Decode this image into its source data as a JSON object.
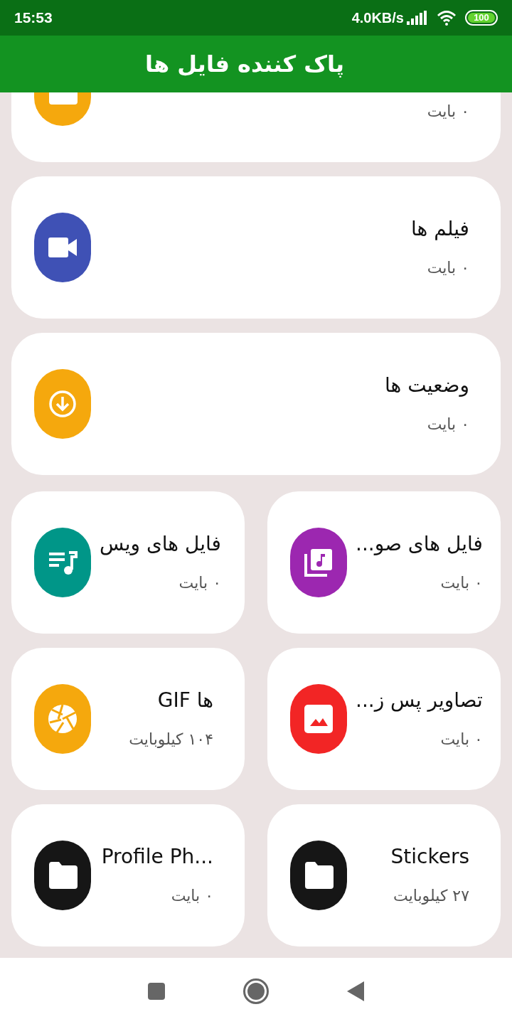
{
  "status_bar": {
    "time": "15:53",
    "speed": "4.0KB/s",
    "battery": "100"
  },
  "app_bar": {
    "title": "پاک کننده فایل ها"
  },
  "full_cards": [
    {
      "size": "۰ بایت",
      "kind": "folder",
      "color": "#f5a80d"
    },
    {
      "title": "فیلم ها",
      "size": "۰ بایت",
      "kind": "video",
      "color": "#3f51b5"
    },
    {
      "title": "وضعیت ها",
      "size": "۰ بایت",
      "kind": "download",
      "color": "#f5a80d"
    }
  ],
  "grid_cards": [
    {
      "title": "فایل های صو...",
      "size": "۰ بایت",
      "kind": "music-library",
      "color": "#9c27b0"
    },
    {
      "title": "فایل های ویس",
      "size": "۰ بایت",
      "kind": "playlist",
      "color": "#009688"
    },
    {
      "title": "تصاویر پس ز...",
      "size": "۰ بایت",
      "kind": "image",
      "color": "#f22525"
    },
    {
      "title": "GIF ها",
      "size": "۱۰۴ کیلوبایت",
      "kind": "aperture",
      "color": "#f5a80d"
    },
    {
      "title": "Stickers",
      "size": "۲۷ کیلوبایت",
      "kind": "folder",
      "color": "#161616"
    },
    {
      "title": "Profile Ph...",
      "size": "۰ بایت",
      "kind": "folder",
      "color": "#161616"
    }
  ]
}
